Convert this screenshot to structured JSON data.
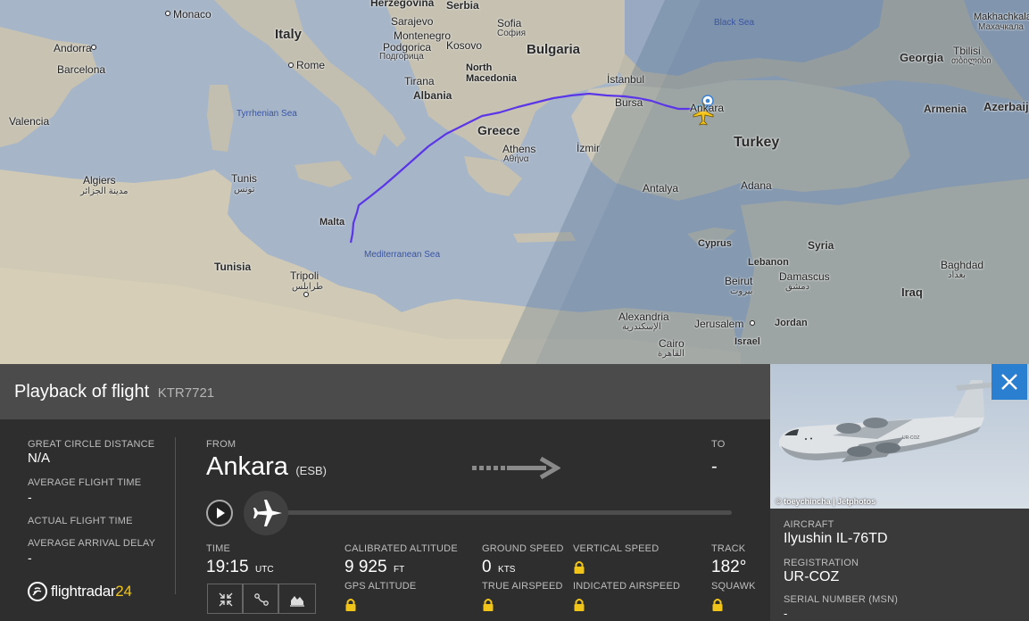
{
  "map": {
    "labels": {
      "monaco": "Monaco",
      "herzegovina": "Herzegovina",
      "serbia": "Serbia",
      "andorra": "Andorra",
      "italy": "Italy",
      "sarajevo": "Sarajevo",
      "sofia": "Sofia",
      "sofia_native": "София",
      "montenegro": "Montenegro",
      "podgorica": "Podgorica",
      "podgorica_native": "Подгорица",
      "kosovo": "Kosovo",
      "bulgaria": "Bulgaria",
      "black_sea": "Black Sea",
      "makhachkala": "Makhachkala",
      "makhachkala_native": "Махачкала",
      "barcelona": "Barcelona",
      "rome": "Rome",
      "tirana": "Tirana",
      "north_macedonia": "North\nMacedonia",
      "istanbul": "İstanbul",
      "georgia": "Georgia",
      "tbilisi": "Tbilisi",
      "tbilisi_native": "თბილისი",
      "albania": "Albania",
      "bursa": "Bursa",
      "ankara": "Ankara",
      "armenia": "Armenia",
      "azerbaijan": "Azerbaij",
      "valencia": "Valencia",
      "tyrrhenian_sea": "Tyrrhenian Sea",
      "greece": "Greece",
      "izmir": "İzmir",
      "turkey": "Turkey",
      "athens": "Athens",
      "athens_native": "Αθήνα",
      "algiers": "Algiers",
      "algiers_native": "مدينة الجزائر",
      "tunis": "Tunis",
      "tunis_native": "تونس",
      "antalya": "Antalya",
      "adana": "Adana",
      "malta": "Malta",
      "cyprus": "Cyprus",
      "syria": "Syria",
      "mediterranean_sea": "Mediterranean Sea",
      "tunisia": "Tunisia",
      "lebanon": "Lebanon",
      "baghdad": "Baghdad",
      "baghdad_native": "بغداد",
      "beirut": "Beirut",
      "beirut_native": "بيروت",
      "damascus": "Damascus",
      "damascus_native": "دمشق",
      "tripoli": "Tripoli",
      "tripoli_native": "طرابلس",
      "iraq": "Iraq",
      "alexandria": "Alexandria",
      "alexandria_native": "الإسكندرية",
      "jerusalem": "Jerusalem",
      "jordan": "Jordan",
      "israel": "Israel",
      "cairo": "Cairo",
      "cairo_native": "القاهرة"
    }
  },
  "flight": {
    "title": "Playback of flight",
    "callsign": "KTR7721",
    "great_circle_label": "GREAT CIRCLE DISTANCE",
    "great_circle_value": "N/A",
    "avg_flight_time_label": "AVERAGE FLIGHT TIME",
    "avg_flight_time_value": "-",
    "actual_flight_time_label": "ACTUAL FLIGHT TIME",
    "avg_arrival_delay_label": "AVERAGE ARRIVAL DELAY",
    "avg_arrival_delay_value": "-",
    "from_label": "FROM",
    "from_city": "Ankara",
    "from_code": "(ESB)",
    "to_label": "TO",
    "to_value": "-",
    "progress": 0.0,
    "time_label": "TIME",
    "time_value": "19:15",
    "time_unit": "UTC",
    "cal_alt_label": "CALIBRATED ALTITUDE",
    "cal_alt_value": "9 925",
    "cal_alt_unit": "FT",
    "gps_alt_label": "GPS ALTITUDE",
    "ground_speed_label": "GROUND SPEED",
    "ground_speed_value": "0",
    "ground_speed_unit": "KTS",
    "true_airspeed_label": "TRUE AIRSPEED",
    "vertical_speed_label": "VERTICAL SPEED",
    "indicated_airspeed_label": "INDICATED AIRSPEED",
    "track_label": "TRACK",
    "track_value": "182°",
    "squawk_label": "SQUAWK"
  },
  "logo": {
    "text": "flightradar",
    "number": "24"
  },
  "aircraft": {
    "photo_credit": "© toeychincha | Jetphotos",
    "aircraft_label": "AIRCRAFT",
    "aircraft_value": "Ilyushin IL-76TD",
    "registration_label": "REGISTRATION",
    "registration_value": "UR-COZ",
    "serial_label": "SERIAL NUMBER (MSN)",
    "serial_value": "-",
    "tail_text": "UR-COZ"
  },
  "colors": {
    "route": "#5b36e8",
    "accent_close": "#2a7fd0",
    "logo_number": "#f0c419"
  },
  "icons": [
    "close-icon",
    "play-icon",
    "airplane-icon",
    "route-arrow-icon",
    "compress-icon",
    "route-icon",
    "chart-icon",
    "lock-icon"
  ]
}
